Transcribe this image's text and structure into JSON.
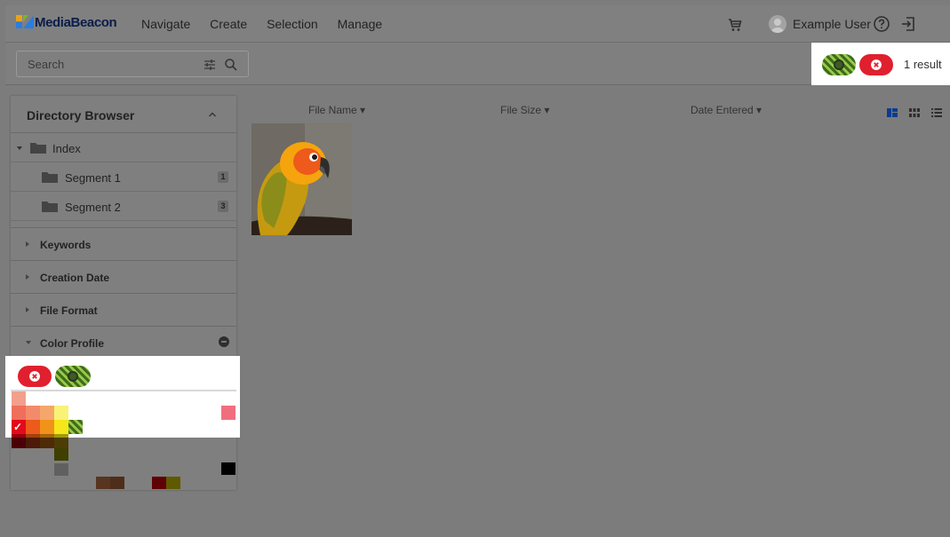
{
  "header": {
    "logo_text": "MediaBeacon",
    "nav": [
      "Navigate",
      "Create",
      "Selection",
      "Manage"
    ],
    "user_name": "Example User",
    "icons": [
      "cart-icon",
      "user-avatar",
      "help-icon",
      "logout-icon"
    ]
  },
  "search": {
    "placeholder": "Search"
  },
  "results": {
    "count_label": "1 result"
  },
  "sidebar": {
    "directory_title": "Directory Browser",
    "tree": [
      {
        "label": "Index",
        "count": ""
      },
      {
        "label": "Segment 1",
        "count": "1"
      },
      {
        "label": "Segment 2",
        "count": "3"
      }
    ],
    "facets": [
      "Keywords",
      "Creation Date",
      "File Format",
      "Color Profile"
    ]
  },
  "columns": [
    "File Name ▾",
    "File Size ▾",
    "Date Entered ▾"
  ],
  "colors": {
    "accent_blue": "#0d3b8f",
    "red_pill": "#e0202e",
    "hatch_dark": "#3d6d1b",
    "hatch_light": "#9bc84c"
  }
}
